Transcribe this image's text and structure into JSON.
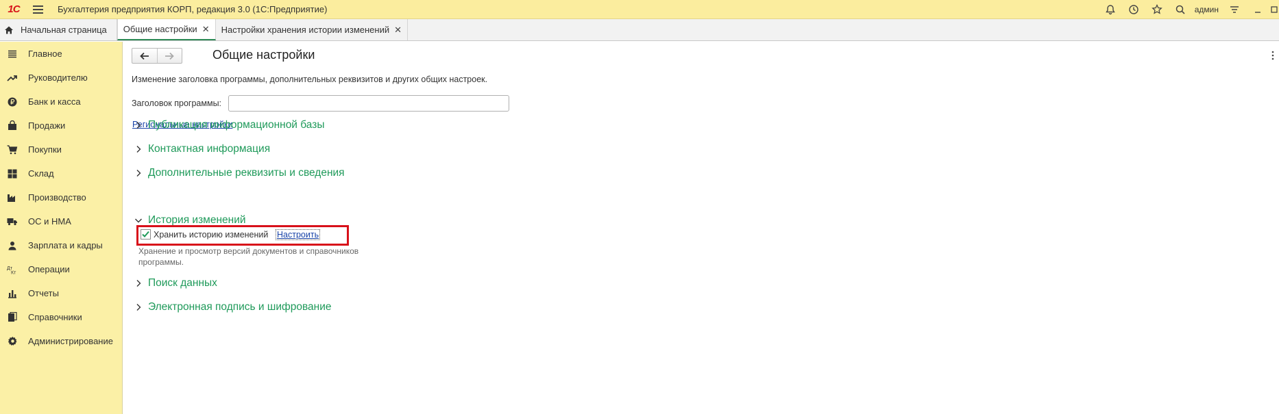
{
  "app": {
    "logo_text": "1С",
    "title": "Бухгалтерия предприятия КОРП, редакция 3.0  (1С:Предприятие)",
    "user": "админ"
  },
  "colors": {
    "titlebar": "#fbed9e",
    "sidebar": "#fbf0a6",
    "group_header": "#1f9a5a",
    "link": "#1a44a8",
    "highlight_box": "#d8101a"
  },
  "tabs": [
    {
      "label": "Начальная страница",
      "icon": "home-icon"
    },
    {
      "label": "Общие настройки",
      "active": true
    },
    {
      "label": "Настройки хранения истории изменений"
    }
  ],
  "sidebar": {
    "items": [
      {
        "label": "Главное",
        "icon": "menu-lines-icon"
      },
      {
        "label": "Руководителю",
        "icon": "trend-up-icon"
      },
      {
        "label": "Банк и касса",
        "icon": "ruble-coin-icon"
      },
      {
        "label": "Продажи",
        "icon": "shopping-bag-icon"
      },
      {
        "label": "Покупки",
        "icon": "cart-icon"
      },
      {
        "label": "Склад",
        "icon": "warehouse-grid-icon"
      },
      {
        "label": "Производство",
        "icon": "factory-icon"
      },
      {
        "label": "ОС и НМА",
        "icon": "truck-icon"
      },
      {
        "label": "Зарплата и кадры",
        "icon": "person-icon"
      },
      {
        "label": "Операции",
        "icon": "debit-credit-icon"
      },
      {
        "label": "Отчеты",
        "icon": "bar-chart-icon"
      },
      {
        "label": "Справочники",
        "icon": "books-icon"
      },
      {
        "label": "Администрирование",
        "icon": "gear-icon"
      }
    ]
  },
  "main": {
    "page_title": "Общие настройки",
    "description": "Изменение заголовка программы, дополнительных реквизитов и других общих настроек.",
    "program_title_label": "Заголовок программы:",
    "program_title_value": "",
    "regional_link": "Региональные настройки",
    "groups": [
      {
        "label": "Публикация информационной базы",
        "expanded": false
      },
      {
        "label": "Контактная информация",
        "expanded": false
      },
      {
        "label": "Дополнительные реквизиты и сведения",
        "expanded": false
      },
      {
        "label": "История изменений",
        "expanded": true
      },
      {
        "label": "Поиск данных",
        "expanded": false
      },
      {
        "label": "Электронная подпись и шифрование",
        "expanded": false
      }
    ],
    "history": {
      "checkbox_label": "Хранить историю изменений",
      "checked": true,
      "config_link": "Настроить",
      "hint": "Хранение и просмотр версий документов и справочников программы."
    }
  }
}
